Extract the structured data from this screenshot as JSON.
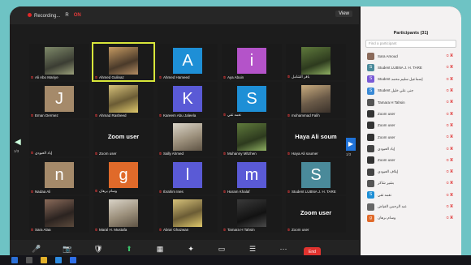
{
  "window": {
    "recording_label": "Recording...",
    "topbar_extra": "R",
    "badge": "ON",
    "view_label": "View"
  },
  "grid": {
    "prev_arrow": "◀",
    "next_arrow": "▶",
    "page_left": "1/3",
    "page_right": "1/3",
    "tiles": [
      {
        "kind": "photo",
        "photo": "p1",
        "label": "Ali Abo Mariye"
      },
      {
        "kind": "photo",
        "photo": "p2",
        "label": "Ahmed Gulinaz",
        "active": true
      },
      {
        "kind": "letter",
        "letter": "A",
        "color": "#1e8fd6",
        "label": "Ahmed Hameed"
      },
      {
        "kind": "letter",
        "letter": "i",
        "color": "#b453c9",
        "label": "Aya Abuin"
      },
      {
        "kind": "photo",
        "photo": "p4",
        "label": "باقر الشامل"
      },
      {
        "kind": "letter",
        "letter": "J",
        "color": "#a58a6a",
        "label": "Eman Dermez"
      },
      {
        "kind": "photo",
        "photo": "p3",
        "label": "Ahmad Rasheed"
      },
      {
        "kind": "letter",
        "letter": "K",
        "color": "#5a5ad6",
        "label": "Kareem Abu Jaleela"
      },
      {
        "kind": "letter",
        "letter": "S",
        "color": "#1e8fd6",
        "label": "نغمه تقي"
      },
      {
        "kind": "photo",
        "photo": "p5",
        "label": "mohammad Falih"
      },
      {
        "kind": "text",
        "text": "",
        "label": "إياد العبودي"
      },
      {
        "kind": "text",
        "text": "Zoom user",
        "label": "Zoom user"
      },
      {
        "kind": "photo",
        "photo": "p7",
        "label": "Sally Ahmed"
      },
      {
        "kind": "photo",
        "photo": "p4",
        "label": "Muhanny Mhzhen"
      },
      {
        "kind": "text",
        "text": "Haya Ali soum",
        "label": "Haya Ali soumer"
      },
      {
        "kind": "letter",
        "letter": "n",
        "color": "#a58a6a",
        "label": "Nadaa Ali"
      },
      {
        "kind": "letter",
        "letter": "g",
        "color": "#e06a2a",
        "label": "وسام برهان"
      },
      {
        "kind": "letter",
        "letter": "l",
        "color": "#5a5ad6",
        "label": "Ibrahim Ines"
      },
      {
        "kind": "letter",
        "letter": "m",
        "color": "#5a5ad6",
        "label": "Haram Khalaf"
      },
      {
        "kind": "letter",
        "letter": "S",
        "color": "#4a8a9a",
        "label": "Student LUBNA J. H. TARE"
      },
      {
        "kind": "photo",
        "photo": "p6",
        "label": "Sara Alaa"
      },
      {
        "kind": "photo",
        "photo": "p7",
        "label": "Maral H. Mustafa"
      },
      {
        "kind": "photo",
        "photo": "p3",
        "label": "Abrar Ghazwan"
      },
      {
        "kind": "photo",
        "photo": "p8",
        "label": "Tamara H Tahsin"
      },
      {
        "kind": "text",
        "text": "Zoom user",
        "label": "Zoom user"
      }
    ]
  },
  "toolbar": {
    "items": [
      {
        "icon": "🎤",
        "icon_name": "mic-icon",
        "label": "Phone"
      },
      {
        "icon": "📷",
        "icon_name": "video-icon",
        "label": "Start Video"
      },
      {
        "icon": "🛡",
        "icon_name": "shield-icon",
        "label": "Security"
      },
      {
        "icon": "⬆",
        "icon_name": "share-icon",
        "label": "Share Screen",
        "share": true
      },
      {
        "icon": "▦",
        "icon_name": "summary-icon",
        "label": "Start Summary"
      },
      {
        "icon": "✦",
        "icon_name": "ai-companion-icon",
        "label": "AI Companion"
      },
      {
        "icon": "▭",
        "icon_name": "whiteboard-icon",
        "label": "Whiteboards"
      },
      {
        "icon": "☰",
        "icon_name": "notes-icon",
        "label": "Notes"
      },
      {
        "icon": "⋯",
        "icon_name": "more-icon",
        "label": "More"
      }
    ],
    "end_label": "End"
  },
  "participants": {
    "title": "Participants (31)",
    "search_placeholder": "Find a participant",
    "rows": [
      {
        "name": "Sara Amoud",
        "color": "#8a6a5a",
        "initial": ""
      },
      {
        "name": "Student LUBNA J. H. TARE",
        "color": "#4a8a9a",
        "initial": "S"
      },
      {
        "name": "Student إسماعيل سليم محمد",
        "color": "#7a5ad6",
        "initial": "S"
      },
      {
        "name": "Student جنى علي خليل",
        "color": "#3a8ad6",
        "initial": "S"
      },
      {
        "name": "Tamara H Tahsin",
        "color": "#555",
        "initial": ""
      },
      {
        "name": "Zoom user",
        "color": "#333",
        "initial": ""
      },
      {
        "name": "Zoom user",
        "color": "#333",
        "initial": ""
      },
      {
        "name": "Zoom user",
        "color": "#333",
        "initial": ""
      },
      {
        "name": "إياد العبودي",
        "color": "#444",
        "initial": ""
      },
      {
        "name": "Zoom user",
        "color": "#333",
        "initial": ""
      },
      {
        "name": "إيلاف العبودي",
        "color": "#444",
        "initial": ""
      },
      {
        "name": "بشير شاكر",
        "color": "#555",
        "initial": ""
      },
      {
        "name": "نغمه تقي",
        "color": "#1e8fd6",
        "initial": "S"
      },
      {
        "name": "عبد الرحمن الفياض",
        "color": "#666",
        "initial": ""
      },
      {
        "name": "وسام برهان",
        "color": "#e06a2a",
        "initial": "g"
      }
    ]
  }
}
